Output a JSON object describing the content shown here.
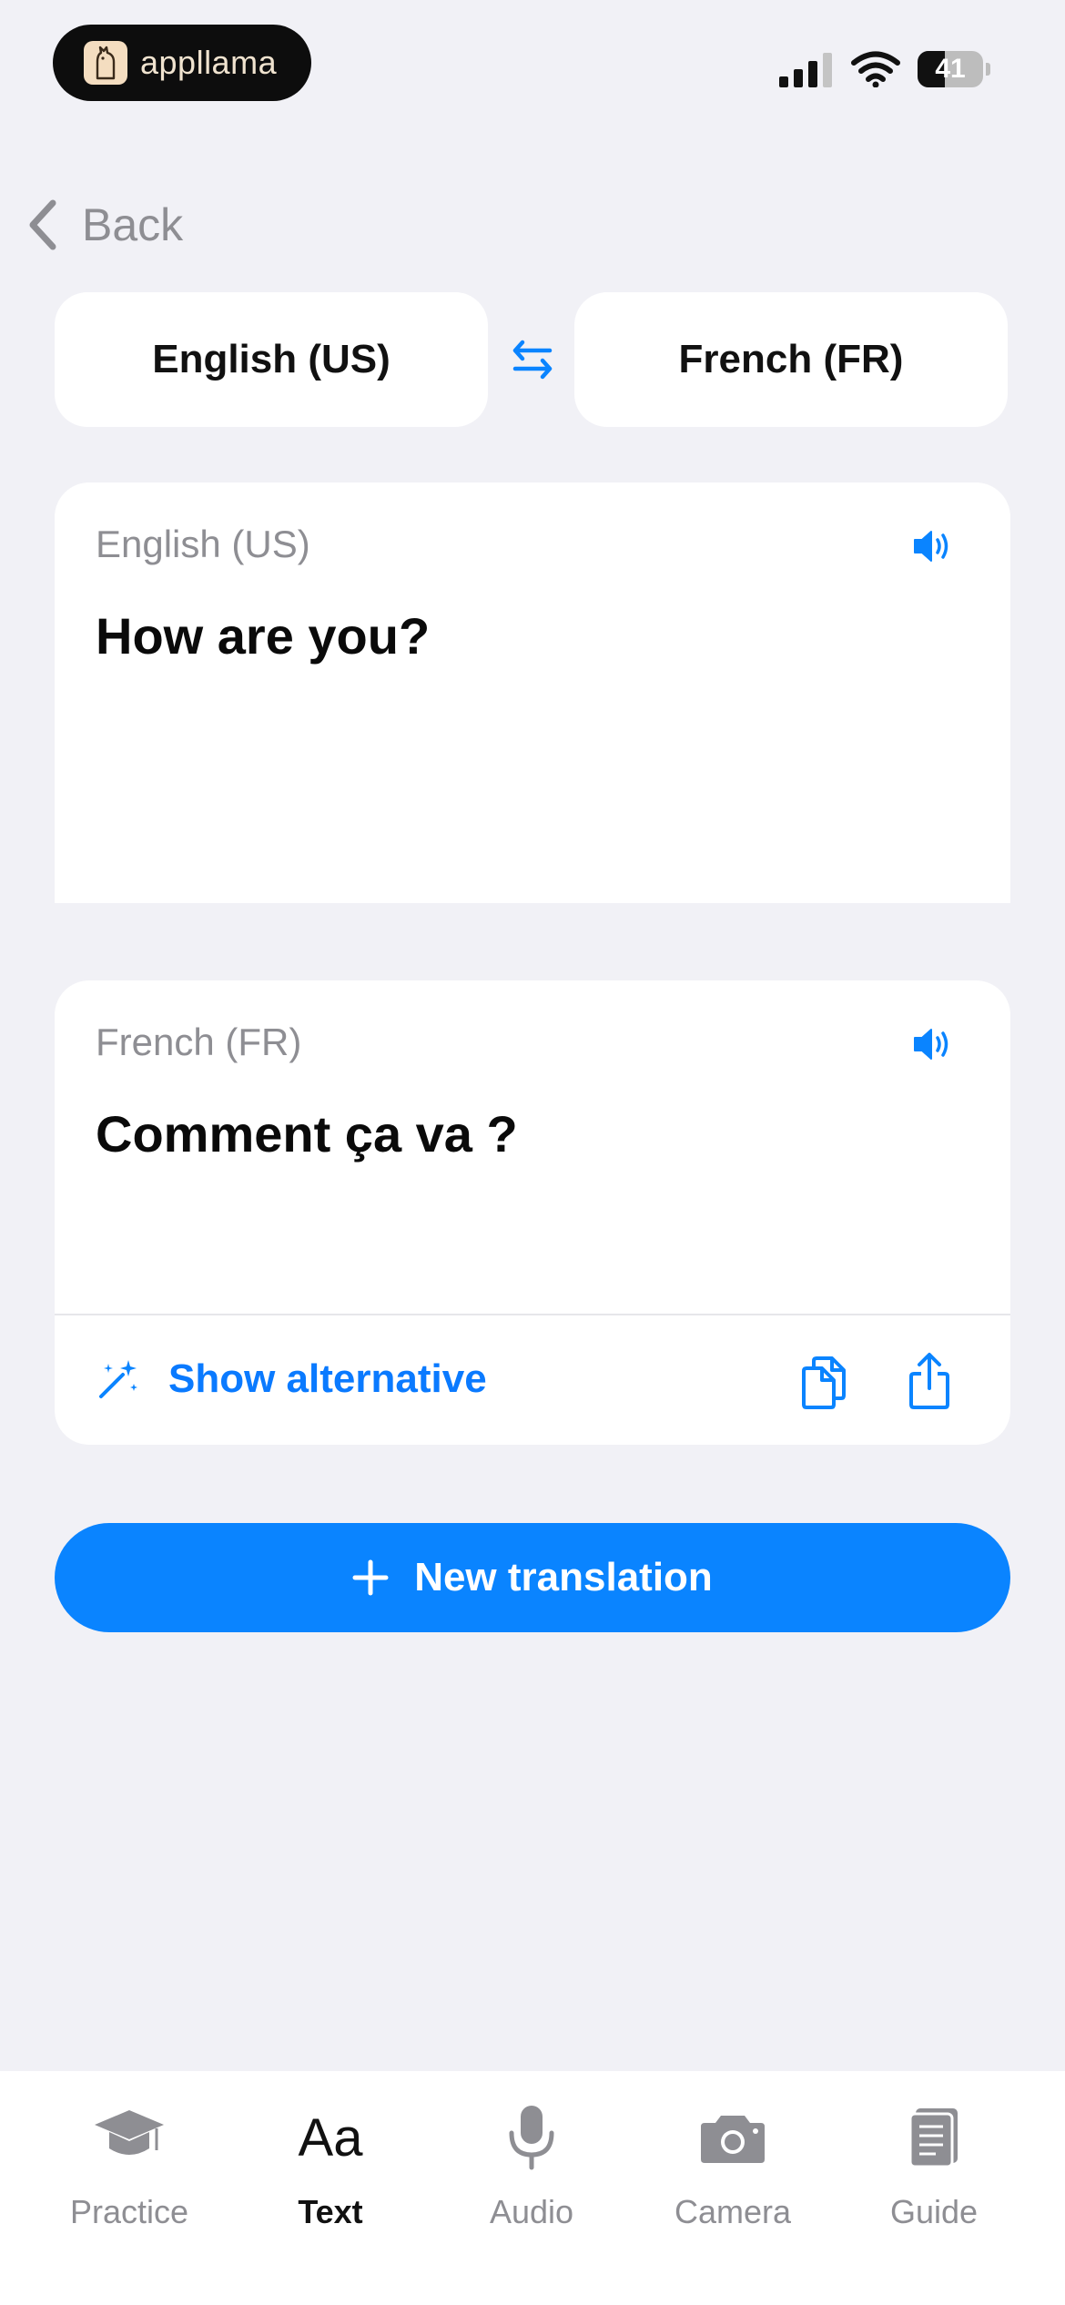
{
  "status_bar": {
    "brand": "appllama",
    "battery": "41",
    "battery_level": 0.41
  },
  "nav": {
    "back_label": "Back"
  },
  "language_selector": {
    "source": "English (US)",
    "target": "French (FR)",
    "swap_icon": "arrows-swap-icon"
  },
  "source_card": {
    "language": "English (US)",
    "text": "How are you?",
    "icon": "speaker-icon"
  },
  "target_card": {
    "language": "French (FR)",
    "text": "Comment ça va ?",
    "icon": "speaker-icon",
    "show_alternative": "Show alternative",
    "actions": [
      "copy-icon",
      "share-icon"
    ]
  },
  "new_translation": {
    "label": "New translation",
    "icon": "plus-icon"
  },
  "tab_bar": {
    "active": "Text",
    "tabs": [
      {
        "label": "Practice",
        "icon": "graduation-cap-icon"
      },
      {
        "label": "Text",
        "icon": "Aa",
        "glyph": "Aa"
      },
      {
        "label": "Audio",
        "icon": "microphone-icon"
      },
      {
        "label": "Camera",
        "icon": "camera-icon"
      },
      {
        "label": "Guide",
        "icon": "book-icon"
      }
    ]
  },
  "colors": {
    "accent": "#0a84ff",
    "link": "#0a7aff",
    "background": "#f1f1f6",
    "muted": "#8e8e93"
  }
}
